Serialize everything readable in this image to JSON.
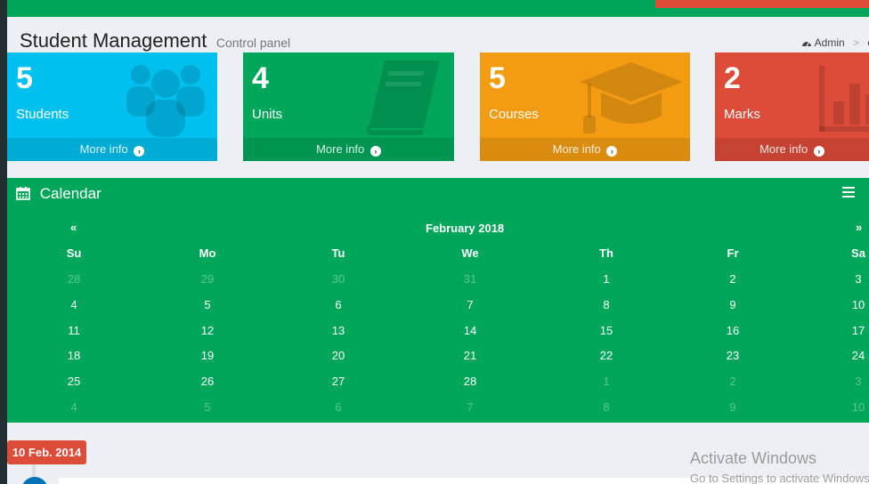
{
  "header": {
    "title": "Student Management",
    "subtitle": "Control panel",
    "breadcrumb": {
      "home": "Admin",
      "separator": ">",
      "current": "c"
    }
  },
  "boxes": [
    {
      "count": "5",
      "label": "Students",
      "more": "More info",
      "color": "#00c0ef",
      "icon": "users-icon"
    },
    {
      "count": "4",
      "label": "Units",
      "more": "More info",
      "color": "#00a65a",
      "icon": "book-icon"
    },
    {
      "count": "5",
      "label": "Courses",
      "more": "More info",
      "color": "#f39c12",
      "icon": "graduation-cap-icon"
    },
    {
      "count": "2",
      "label": "Marks",
      "more": "More info",
      "color": "#dd4b39",
      "icon": "bar-chart-icon"
    }
  ],
  "calendar": {
    "title": "Calendar",
    "prev": "«",
    "next": "»",
    "month": "February 2018",
    "weekdays": [
      "Su",
      "Mo",
      "Tu",
      "We",
      "Th",
      "Fr",
      "Sa"
    ],
    "weeks": [
      [
        "28",
        "29",
        "30",
        "31",
        "1",
        "2",
        "3"
      ],
      [
        "4",
        "5",
        "6",
        "7",
        "8",
        "9",
        "10"
      ],
      [
        "11",
        "12",
        "13",
        "14",
        "15",
        "16",
        "17"
      ],
      [
        "18",
        "19",
        "20",
        "21",
        "22",
        "23",
        "24"
      ],
      [
        "25",
        "26",
        "27",
        "28",
        "1",
        "2",
        "3"
      ],
      [
        "4",
        "5",
        "6",
        "7",
        "8",
        "9",
        "10"
      ]
    ],
    "muted": [
      [
        true,
        true,
        true,
        true,
        false,
        false,
        false
      ],
      [
        false,
        false,
        false,
        false,
        false,
        false,
        false
      ],
      [
        false,
        false,
        false,
        false,
        false,
        false,
        false
      ],
      [
        false,
        false,
        false,
        false,
        false,
        false,
        false
      ],
      [
        false,
        false,
        false,
        false,
        true,
        true,
        true
      ],
      [
        true,
        true,
        true,
        true,
        true,
        true,
        true
      ]
    ],
    "color": "#00a65a"
  },
  "timeline": {
    "date_label": "10 Feb. 2014"
  },
  "watermark": {
    "line1": "Activate Windows",
    "line2": "Go to Settings to activate Windows."
  }
}
